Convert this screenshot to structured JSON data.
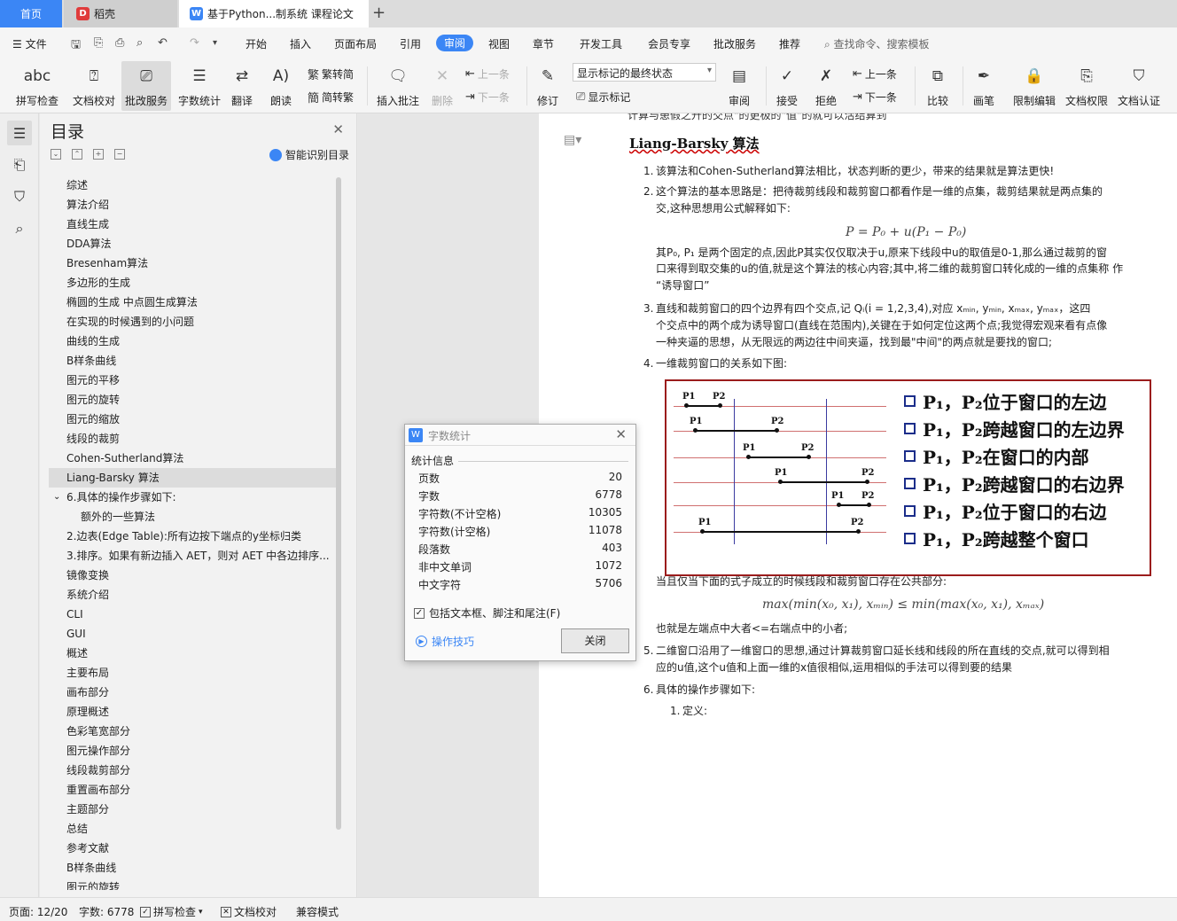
{
  "tabs": {
    "home": "首页",
    "daoke": "稻壳",
    "doc": "基于Python...制系统 课程论文",
    "plus": "+"
  },
  "menu": {
    "file": "文件",
    "items": [
      "开始",
      "插入",
      "页面布局",
      "引用",
      "审阅",
      "视图",
      "章节",
      "开发工具",
      "会员专享",
      "批改服务",
      "推荐"
    ],
    "search": "查找命令、搜索模板"
  },
  "toolbar": {
    "spell": "拼写检查",
    "proof": "文档校对",
    "correct": "批改服务",
    "wordcount": "字数统计",
    "translate": "翻译",
    "read": "朗读",
    "to_trad": "繁转简",
    "to_simp": "简转繁",
    "insert_comment": "插入批注",
    "delete": "删除",
    "prev": "上一条",
    "next": "下一条",
    "revise": "修订",
    "markup_select": "显示标记的最终状态",
    "show_markup": "显示标记",
    "review": "审阅",
    "accept": "接受",
    "reject": "拒绝",
    "prev2": "上一条",
    "next2": "下一条",
    "compare": "比较",
    "pen": "画笔",
    "restrict": "限制编辑",
    "rights": "文档权限",
    "certify": "文档认证"
  },
  "toc": {
    "title": "目录",
    "smart": "智能识别目录",
    "items": [
      {
        "label": "综述",
        "level": 1
      },
      {
        "label": "算法介绍",
        "level": 1
      },
      {
        "label": "直线生成",
        "level": 1
      },
      {
        "label": "DDA算法",
        "level": 1
      },
      {
        "label": "Bresenham算法",
        "level": 1
      },
      {
        "label": "多边形的生成",
        "level": 1
      },
      {
        "label": "椭圆的生成 中点圆生成算法",
        "level": 1
      },
      {
        "label": "在实现的时候遇到的小问题",
        "level": 1
      },
      {
        "label": "曲线的生成",
        "level": 1
      },
      {
        "label": "B样条曲线",
        "level": 1
      },
      {
        "label": "图元的平移",
        "level": 1
      },
      {
        "label": "图元的旋转",
        "level": 1
      },
      {
        "label": "图元的缩放",
        "level": 1
      },
      {
        "label": "线段的裁剪",
        "level": 1
      },
      {
        "label": "Cohen-Sutherland算法",
        "level": 1
      },
      {
        "label": "Liang-Barsky 算法",
        "level": 1,
        "active": true
      },
      {
        "label": "6.具体的操作步骤如下:",
        "level": 1,
        "expanded": true
      },
      {
        "label": "额外的一些算法",
        "level": 2
      },
      {
        "label": "2.边表(Edge Table):所有边按下端点的y坐标归类",
        "level": 1
      },
      {
        "label": "3.排序。如果有新边插入 AET，则对 AET 中各边排序...",
        "level": 1
      },
      {
        "label": "镜像变换",
        "level": 1
      },
      {
        "label": "系统介绍",
        "level": 1
      },
      {
        "label": "CLI",
        "level": 1
      },
      {
        "label": "GUI",
        "level": 1
      },
      {
        "label": "概述",
        "level": 1
      },
      {
        "label": "主要布局",
        "level": 1
      },
      {
        "label": "画布部分",
        "level": 1
      },
      {
        "label": "原理概述",
        "level": 1
      },
      {
        "label": "色彩笔宽部分",
        "level": 1
      },
      {
        "label": "图元操作部分",
        "level": 1
      },
      {
        "label": "线段裁剪部分",
        "level": 1
      },
      {
        "label": "重置画布部分",
        "level": 1
      },
      {
        "label": "主题部分",
        "level": 1
      },
      {
        "label": "总结",
        "level": 1
      },
      {
        "label": "参考文献",
        "level": 1
      },
      {
        "label": "B样条曲线",
        "level": 1
      },
      {
        "label": "图元的旋转",
        "level": 1
      }
    ]
  },
  "doc": {
    "cut_line": "计算与患假之升的交点\"的更极的\"值\"的就可以活结算到",
    "heading": "Liang-Barsky 算法",
    "items": [
      {
        "num": "1.",
        "lines": [
          "该算法和Cohen-Sutherland算法相比，状态判断的更少，带来的结果就是算法更快!"
        ]
      },
      {
        "num": "2.",
        "lines": [
          "这个算法的基本思路是：把待裁剪线段和裁剪窗口都看作是一维的点集，裁剪结果就是两点集的",
          "交,这种思想用公式解释如下:"
        ]
      },
      {
        "num": "3.",
        "lines": [
          "直线和裁剪窗口的四个边界有四个交点,记 Qᵢ(i = 1,2,3,4),对应   xₘᵢₙ, yₘᵢₙ, xₘₐₓ, yₘₐₓ，这四",
          "个交点中的两个成为诱导窗口(直线在范围内),关键在于如何定位这两个点;我觉得宏观来看有点像",
          "一种夹逼的思想，从无限远的两边往中间夹逼，找到最\"中间\"的两点就是要找的窗口;"
        ]
      },
      {
        "num": "4.",
        "lines": [
          "一维裁剪窗口的关系如下图:"
        ]
      },
      {
        "num": "5.",
        "lines": [
          "二维窗口沿用了一维窗口的思想,通过计算裁剪窗口延长线和线段的所在直线的交点,就可以得到相",
          "应的u值,这个u值和上面一维的x值很相似,运用相似的手法可以得到要的结果"
        ]
      },
      {
        "num": "6.",
        "lines": [
          "具体的操作步骤如下:"
        ]
      }
    ],
    "formula1": "P = P₀ + u(P₁ − P₀)",
    "para2": [
      "其P₀, P₁ 是两个固定的点,因此P其实仅仅取决于u,原来下线段中u的取值是0-1,那么通过裁剪的窗",
      "口来得到取交集的u的值,就是这个算法的核心内容;其中,将二维的裁剪窗口转化成的一维的点集称   作",
      "“诱导窗口”"
    ],
    "after_fig": "当且仅当下面的式子成立的时候线段和裁剪窗口存在公共部分:",
    "formula2": "max(min(x₀, x₁), xₘᵢₙ) ≤ min(max(x₀, x₁), xₘₐₓ)",
    "after_formula": "也就是左端点中大者<=右端点中的小者;",
    "sub1_num": "1.",
    "sub1": "定义:",
    "figure_rows": [
      "P₁，P₂位于窗口的左边",
      "P₁，P₂跨越窗口的左边界",
      "P₁，P₂在窗口的内部",
      "P₁，P₂跨越窗口的右边界",
      "P₁，P₂位于窗口的右边",
      "P₁，P₂跨越整个窗口"
    ],
    "p1": "P1",
    "p2": "P2"
  },
  "dialog": {
    "title": "字数统计",
    "section": "统计信息",
    "rows": [
      {
        "label": "页数",
        "value": "20"
      },
      {
        "label": "字数",
        "value": "6778"
      },
      {
        "label": "字符数(不计空格)",
        "value": "10305"
      },
      {
        "label": "字符数(计空格)",
        "value": "11078"
      },
      {
        "label": "段落数",
        "value": "403"
      },
      {
        "label": "非中文单词",
        "value": "1072"
      },
      {
        "label": "中文字符",
        "value": "5706"
      }
    ],
    "checkbox": "包括文本框、脚注和尾注(F)",
    "tips": "操作技巧",
    "close": "关闭"
  },
  "status": {
    "page": "页面: 12/20",
    "words": "字数: 6778",
    "spell": "拼写检查",
    "proof": "文档校对",
    "compat": "兼容模式"
  },
  "colors": {
    "accent": "#3b86f5",
    "figure_border": "#9b1c1c"
  }
}
